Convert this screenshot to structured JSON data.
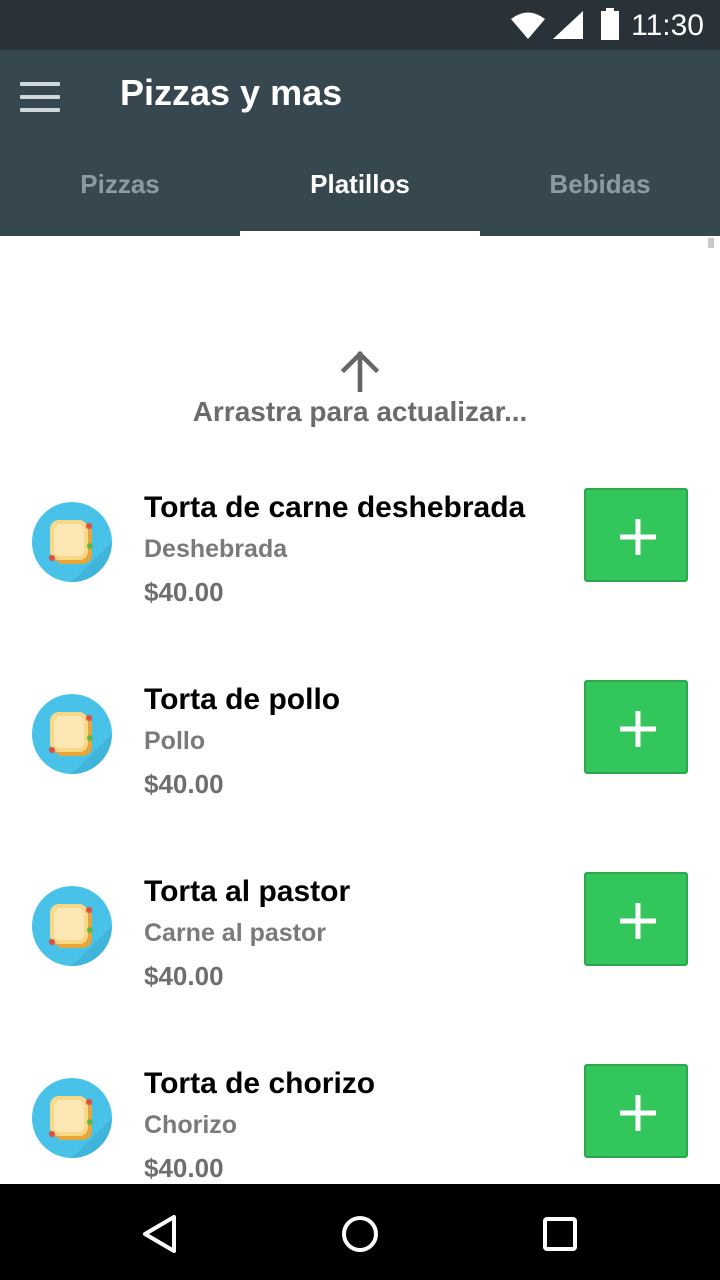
{
  "status_bar": {
    "time": "11:30",
    "icons": [
      "wifi-icon",
      "signal-icon",
      "battery-icon"
    ]
  },
  "app_bar": {
    "title": "Pizzas y mas",
    "menu_icon": "hamburger-menu-icon",
    "background": "#37474f"
  },
  "tabs": [
    {
      "label": "Pizzas",
      "active": false
    },
    {
      "label": "Platillos",
      "active": true
    },
    {
      "label": "Bebidas",
      "active": false
    }
  ],
  "pull_refresh": {
    "icon": "arrow-up-icon",
    "text": "Arrastra para actualizar..."
  },
  "items": [
    {
      "name": "Torta de carne deshebrada",
      "description": "Deshebrada",
      "price": "$40.00",
      "icon": "sandwich-icon"
    },
    {
      "name": "Torta de pollo",
      "description": "Pollo",
      "price": "$40.00",
      "icon": "sandwich-icon"
    },
    {
      "name": "Torta al pastor",
      "description": "Carne al pastor",
      "price": "$40.00",
      "icon": "sandwich-icon"
    },
    {
      "name": "Torta de chorizo",
      "description": "Chorizo",
      "price": "$40.00",
      "icon": "sandwich-icon"
    }
  ],
  "add_button": {
    "icon": "plus-icon",
    "color": "#33c65c"
  },
  "nav_bar": {
    "buttons": [
      "back-icon",
      "home-icon",
      "recents-icon"
    ]
  }
}
